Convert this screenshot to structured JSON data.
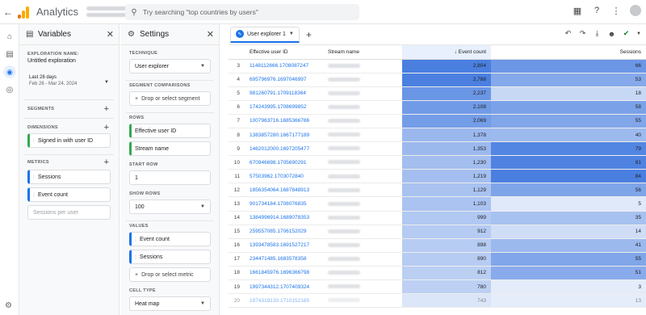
{
  "app": {
    "title": "Analytics"
  },
  "search": {
    "placeholder": "Try searching \"top countries by users\""
  },
  "variables": {
    "title": "Variables",
    "exploration_name_label": "EXPLORATION NAME:",
    "exploration_name": "Untitled exploration",
    "date_label": "Last 28 days",
    "date_range": "Feb 26 - Mar 24, 2024",
    "segments_label": "SEGMENTS",
    "dimensions_label": "DIMENSIONS",
    "dimensions": [
      "Signed in with user ID"
    ],
    "metrics_label": "METRICS",
    "metrics": [
      "Sessions",
      "Event count",
      "Sessions per user"
    ]
  },
  "settings": {
    "title": "Settings",
    "technique_label": "TECHNIQUE",
    "technique": "User explorer",
    "segment_comparisons_label": "SEGMENT COMPARISONS",
    "drop_segment": "Drop or select segment",
    "rows_label": "ROWS",
    "rows": [
      "Effective user ID",
      "Stream name"
    ],
    "start_row_label": "START ROW",
    "start_row": "1",
    "show_rows_label": "SHOW ROWS",
    "show_rows": "100",
    "values_label": "VALUES",
    "values": [
      "Event count",
      "Sessions"
    ],
    "drop_metric": "Drop or select metric",
    "cell_type_label": "CELL TYPE",
    "cell_type": "Heat map"
  },
  "tab": {
    "label": "User explorer 1"
  },
  "table": {
    "headers": {
      "id": "Effective user ID",
      "stream": "Stream name",
      "events": "Event count",
      "sessions": "Sessions"
    },
    "heat_color": "#4a7fe0",
    "rows": [
      {
        "idx": "3",
        "id": "1148112666.1708087247",
        "events": "2,804",
        "sessions": "66"
      },
      {
        "idx": "4",
        "id": "695796976.1697046997",
        "events": "2,788",
        "sessions": "53"
      },
      {
        "idx": "5",
        "id": "981260791.1709118364",
        "events": "2,237",
        "sessions": "18"
      },
      {
        "idx": "6",
        "id": "174243995.1708699852",
        "events": "2,108",
        "sessions": "58"
      },
      {
        "idx": "7",
        "id": "1007963716.1685366786",
        "events": "2,069",
        "sessions": "55"
      },
      {
        "idx": "8",
        "id": "1383857280.1667177189",
        "events": "1,378",
        "sessions": "40"
      },
      {
        "idx": "9",
        "id": "1462012000.1697205477",
        "events": "1,353",
        "sessions": "79"
      },
      {
        "idx": "10",
        "id": "670946698.1705690291",
        "events": "1,230",
        "sessions": "81"
      },
      {
        "idx": "11",
        "id": "57503962.1703072840",
        "events": "1,219",
        "sessions": "84"
      },
      {
        "idx": "12",
        "id": "1856354064.1687848913",
        "events": "1,129",
        "sessions": "56"
      },
      {
        "idx": "13",
        "id": "901734184.1708076835",
        "events": "1,103",
        "sessions": "5"
      },
      {
        "idx": "14",
        "id": "1384996914.1689078353",
        "events": "999",
        "sessions": "35"
      },
      {
        "idx": "15",
        "id": "259557085.1706152029",
        "events": "912",
        "sessions": "14"
      },
      {
        "idx": "16",
        "id": "1393478583.1691527217",
        "events": "898",
        "sessions": "41"
      },
      {
        "idx": "17",
        "id": "234471485.1683578358",
        "events": "890",
        "sessions": "55"
      },
      {
        "idx": "18",
        "id": "1661845976.1696366798",
        "events": "812",
        "sessions": "51"
      },
      {
        "idx": "19",
        "id": "1997344312.1707409324",
        "events": "780",
        "sessions": "3"
      },
      {
        "idx": "20",
        "id": "1974319130.1710152165",
        "events": "743",
        "sessions": "13"
      }
    ]
  }
}
